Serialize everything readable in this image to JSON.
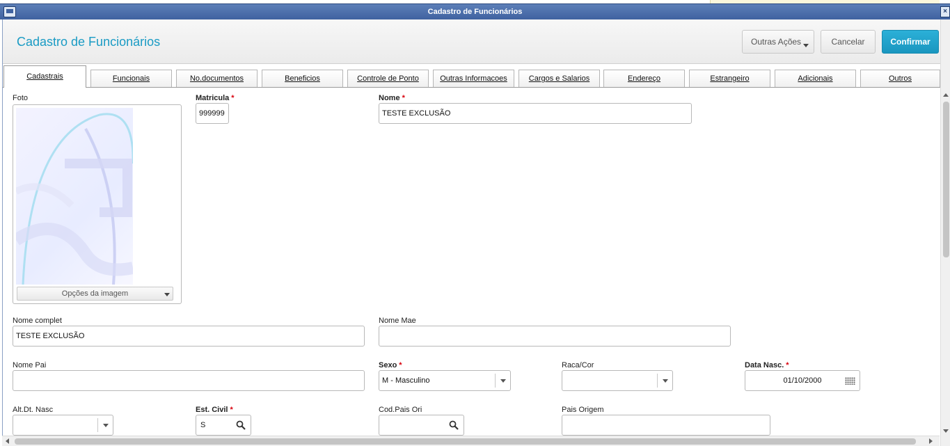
{
  "window": {
    "title": "Cadastro de Funcionários"
  },
  "header": {
    "title": "Cadastro de Funcionários",
    "other_actions": "Outras Ações",
    "cancel": "Cancelar",
    "confirm": "Confirmar"
  },
  "tabs": [
    {
      "label": "Cadastrais",
      "active": true
    },
    {
      "label": "Funcionais"
    },
    {
      "label": "No.documentos"
    },
    {
      "label": "Beneficios"
    },
    {
      "label": "Controle de Ponto"
    },
    {
      "label": "Outras Informacoes"
    },
    {
      "label": "Cargos e Salarios"
    },
    {
      "label": "Endereço"
    },
    {
      "label": "Estrangeiro"
    },
    {
      "label": "Adicionais"
    },
    {
      "label": "Outros"
    }
  ],
  "form": {
    "foto": {
      "label": "Foto",
      "options_button": "Opções da imagem"
    },
    "matricula": {
      "label": "Matricula",
      "required": "*",
      "value": "999999"
    },
    "nome": {
      "label": "Nome",
      "required": "*",
      "value": "TESTE EXCLUSÃO"
    },
    "nome_complet": {
      "label": "Nome complet",
      "value": "TESTE EXCLUSÃO"
    },
    "nome_mae": {
      "label": "Nome Mae",
      "value": ""
    },
    "nome_pai": {
      "label": "Nome Pai",
      "value": ""
    },
    "sexo": {
      "label": "Sexo",
      "required": "*",
      "value": "M - Masculino"
    },
    "raca_cor": {
      "label": "Raca/Cor",
      "value": ""
    },
    "data_nasc": {
      "label": "Data Nasc.",
      "required": "*",
      "value": "01/10/2000"
    },
    "alt_dt_nasc": {
      "label": "Alt.Dt. Nasc",
      "value": ""
    },
    "est_civil": {
      "label": "Est. Civil",
      "required": "*",
      "value": "S"
    },
    "cod_pais_ori": {
      "label": "Cod.Pais Ori",
      "value": ""
    },
    "pais_origem": {
      "label": "Pais Origem",
      "value": ""
    }
  },
  "colors": {
    "accent": "#1a9bc4",
    "confirm_bg": "#1fa3cc",
    "titlebar": "#4a6ca8",
    "required": "#d8000c"
  },
  "icons": [
    "app-icon",
    "close-icon",
    "caret-down-icon",
    "search-icon",
    "calendar-icon"
  ]
}
